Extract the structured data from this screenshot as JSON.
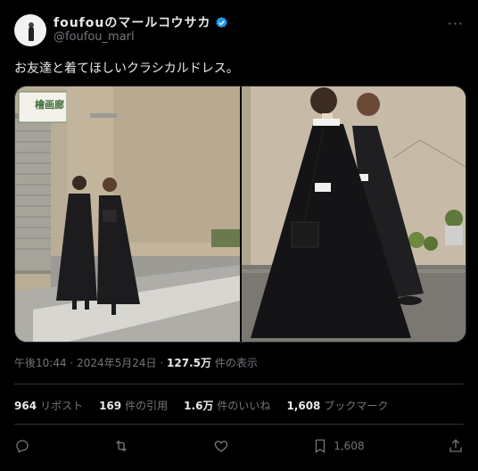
{
  "author": {
    "display_name": "foufouのマールコウサカ",
    "handle": "@foufou_marl"
  },
  "more_label": "···",
  "tweet": {
    "text": "お友達と着てほしいクラシカルドレス。"
  },
  "media": {
    "photo1": {
      "sign_kanji": "檜画廊"
    },
    "photo2": {}
  },
  "meta": {
    "time": "午後10:44",
    "sep": "·",
    "date": "2024年5月24日",
    "views_num": "127.5万",
    "views_label": "件の表示"
  },
  "stats": [
    {
      "num": "964",
      "label": "リポスト"
    },
    {
      "num": "169",
      "label": "件の引用"
    },
    {
      "num": "1.6万",
      "label": "件のいいね"
    },
    {
      "num": "1,608",
      "label": "ブックマーク"
    }
  ],
  "actions": {
    "bookmark_count": "1,608"
  },
  "colors": {
    "accent": "#1d9bf0",
    "text": "#e7e9ea",
    "muted": "#71767b",
    "border": "#2f3336"
  }
}
